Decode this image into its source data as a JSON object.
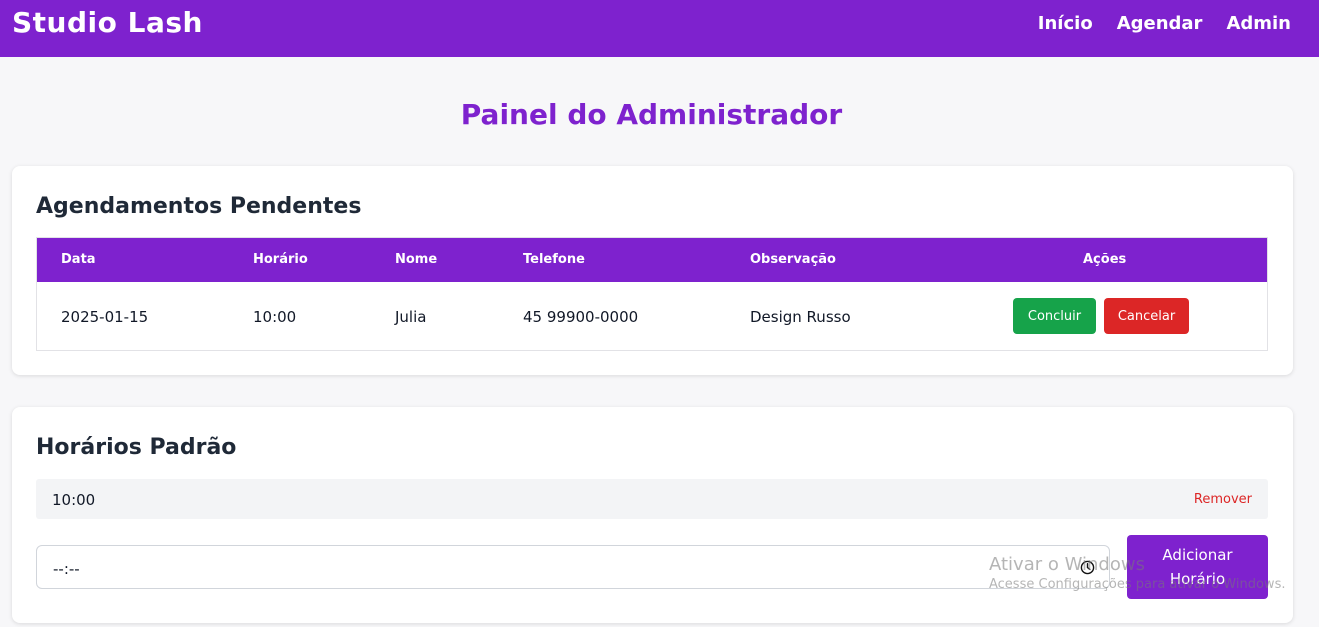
{
  "navbar": {
    "brand": "Studio Lash",
    "links": [
      "Início",
      "Agendar",
      "Admin"
    ]
  },
  "page": {
    "title": "Painel do Administrador"
  },
  "pending": {
    "title": "Agendamentos Pendentes",
    "columns": [
      "Data",
      "Horário",
      "Nome",
      "Telefone",
      "Observação",
      "Ações"
    ],
    "rows": [
      {
        "date": "2025-01-15",
        "time": "10:00",
        "name": "Julia",
        "phone": "45 99900-0000",
        "note": "Design Russo",
        "conclude_label": "Concluir",
        "cancel_label": "Cancelar"
      }
    ]
  },
  "slots": {
    "title": "Horários Padrão",
    "items": [
      {
        "time": "10:00",
        "remove_label": "Remover"
      }
    ],
    "input_value": "--:--",
    "add_label_line1": "Adicionar",
    "add_label_line2": "Horário"
  },
  "watermark": {
    "line1": "Ativar o Windows",
    "line2": "Acesse Configurações para ativar o Windows."
  },
  "colors": {
    "primary": "#7e22ce",
    "success": "#16a34a",
    "danger": "#dc2626"
  },
  "icons": {
    "time_picker": "clock-icon"
  }
}
